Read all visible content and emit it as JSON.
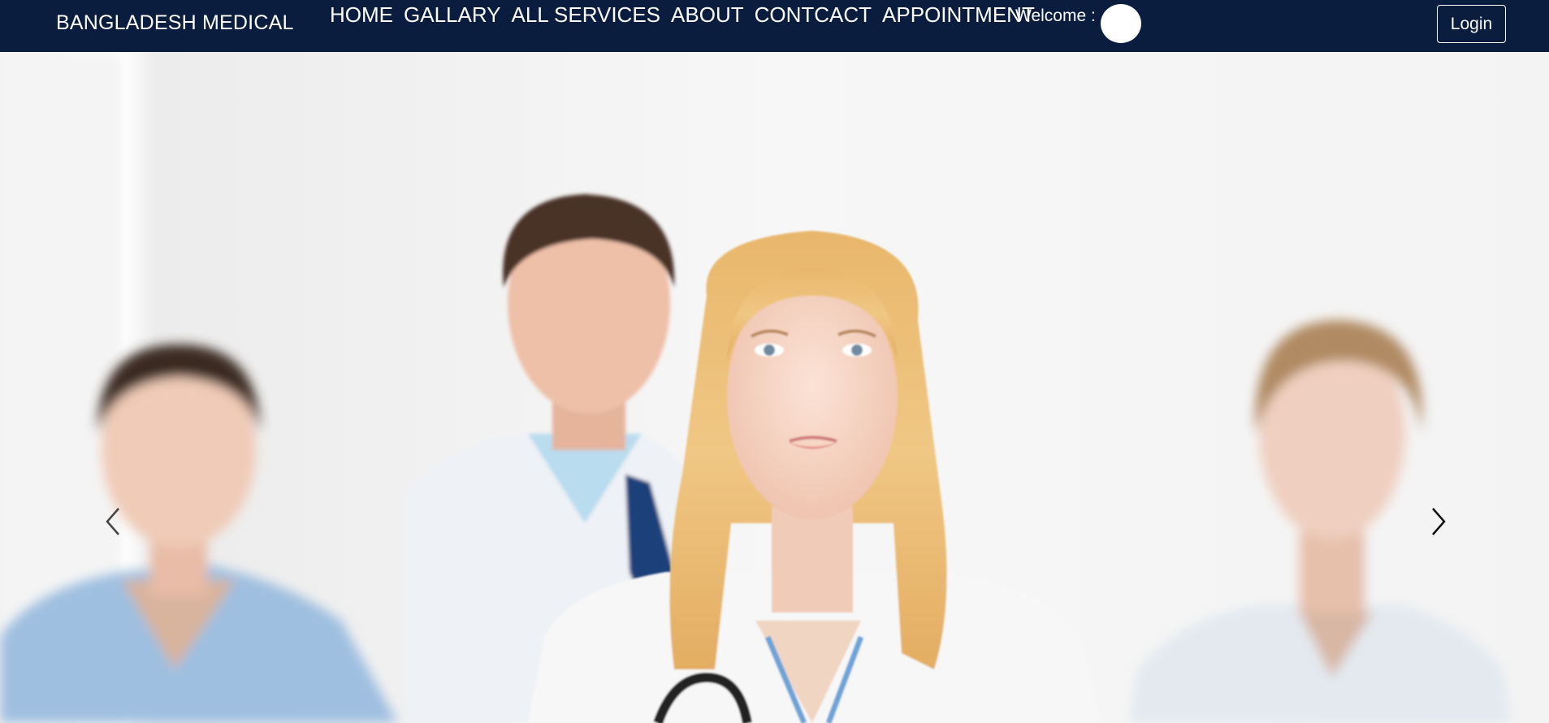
{
  "navbar": {
    "brand": "BANGLADESH MEDICAL",
    "links": [
      {
        "label": "HOME"
      },
      {
        "label": "GALLARY"
      },
      {
        "label": "ALL SERVICES"
      },
      {
        "label": "ABOUT"
      },
      {
        "label": "CONTCACT"
      },
      {
        "label": "APPOINTMENT"
      }
    ],
    "welcome_label": "Welcome :",
    "login_label": "Login"
  },
  "carousel": {
    "image_alt": "",
    "prev_icon": "chevron-left-icon",
    "next_icon": "chevron-right-icon"
  },
  "colors": {
    "navbar_bg": "#0a1d3f",
    "nav_text": "#ffffff"
  }
}
